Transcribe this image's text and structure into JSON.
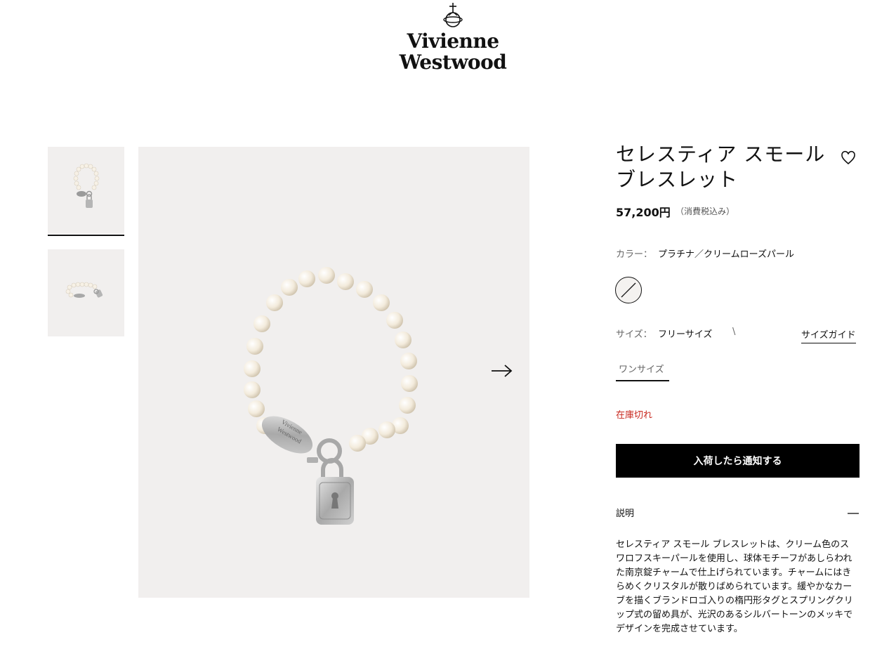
{
  "brand": {
    "line1": "Vivienne",
    "line2": "Westwood"
  },
  "product": {
    "title_line1": "セレスティア スモール",
    "title_line2": "ブレスレット",
    "price": "57,200円",
    "tax_note": "（消費税込み）"
  },
  "color": {
    "label": "カラー：",
    "value": "プラチナ／クリームローズパール"
  },
  "size": {
    "label": "サイズ：",
    "value": "フリーサイズ",
    "tick": "\\",
    "guide_label": "サイズガイド",
    "option": "ワンサイズ"
  },
  "stock_status": "在庫切れ",
  "notify_button": "入荷したら通知する",
  "description": {
    "heading": "説明",
    "body": "セレスティア スモール ブレスレットは、クリーム色のスワロフスキーパールを使用し、球体モチーフがあしらわれた南京錠チャームで仕上げられています。チャームにはきらめくクリスタルが散りばめられています。緩やかなカーブを描くブランドロゴ入りの楕円形タグとスプリングクリップ式の留め具が、光沢のあるシルバートーンのメッキでデザインを完成させています。"
  },
  "icons": {
    "wishlist": "heart-icon",
    "next": "arrow-right-icon",
    "collapse": "minus-icon",
    "swatch": "swatch-unavailable-icon",
    "logo": "orb-logo-icon"
  },
  "colors": {
    "stock_red": "#c8281e",
    "button_black": "#000000",
    "image_bg": "#f1efee"
  }
}
